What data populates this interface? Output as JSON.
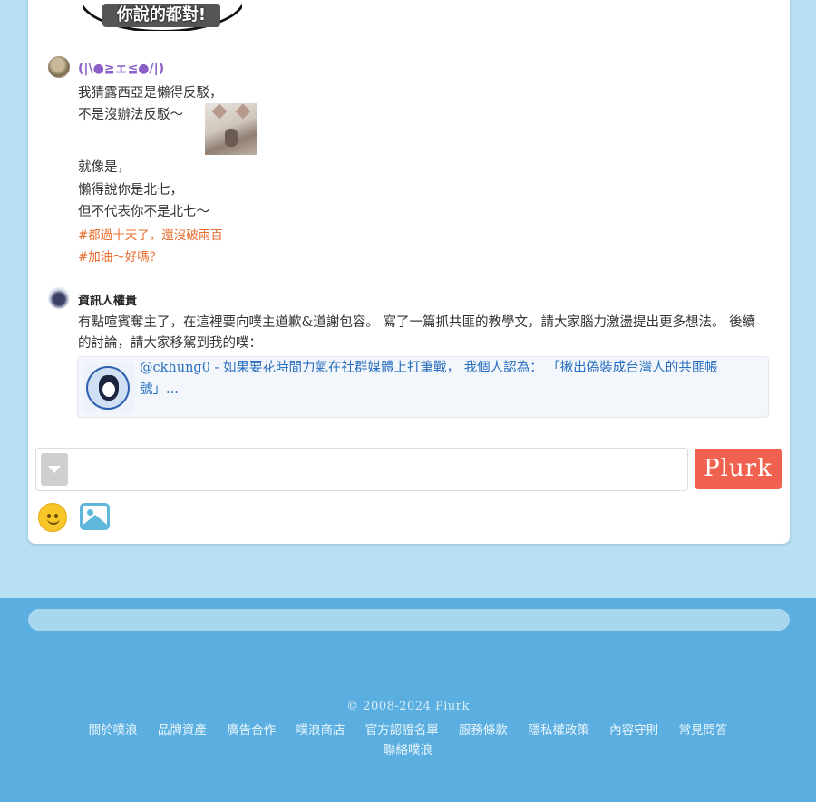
{
  "sticker_text": "你說的都對!",
  "responses": [
    {
      "username": "(|\\●≧ェ≦●/|)",
      "lines": [
        "我猜露西亞是懶得反駁，",
        "不是沒辦法反駁～",
        "就像是，",
        "懶得說你是北七，",
        "但不代表你不是北七～"
      ],
      "tags": [
        "#都過十天了，還沒破兩百",
        "#加油～好嗎？"
      ]
    },
    {
      "username": "資訊人權貴",
      "body": "有點喧賓奪主了，在這裡要向噗主道歉&道謝包容。 寫了一篇抓共匪的教學文，請大家腦力激盪提出更多想法。 後續的討論，請大家移駕到我的噗：",
      "link_text": "@ckhung0 - 如果要花時間力氣在社群媒體上打筆戰， 我個人認為： 「揪出偽裝成台灣人的共匪帳號」..."
    }
  ],
  "composer": {
    "submit_label": "Plurk",
    "input_value": ""
  },
  "footer": {
    "copyright": "© 2008-2024 Plurk",
    "links": [
      "關於噗浪",
      "品牌資產",
      "廣告合作",
      "噗浪商店",
      "官方認證名單",
      "服務條款",
      "隱私權政策",
      "內容守則",
      "常見問答",
      "聯絡噗浪"
    ]
  },
  "colors": {
    "background": "#b7e0f5",
    "footer": "#5aaee0",
    "plurk_button": "#f0614f",
    "tag": "#e86c2d",
    "link": "#2a6fc0"
  },
  "icons": [
    "qualifier-dropdown-icon",
    "emoji-icon",
    "image-upload-icon"
  ]
}
